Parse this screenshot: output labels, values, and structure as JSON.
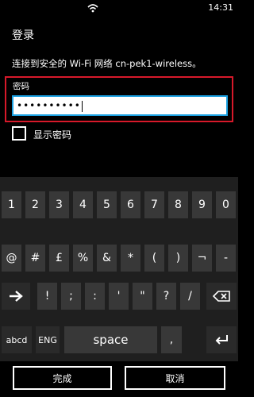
{
  "status": {
    "time": "14:31"
  },
  "page": {
    "title": "登录",
    "description": "连接到安全的 Wi-Fi 网络 cn-pek1-wireless。",
    "password_label": "密码",
    "password_value": "••••••••••",
    "show_password_label": "显示密码"
  },
  "keyboard": {
    "row1": [
      "1",
      "2",
      "3",
      "4",
      "5",
      "6",
      "7",
      "8",
      "9",
      "0"
    ],
    "row2": [
      "@",
      "#",
      "£",
      "%",
      "&",
      "*",
      "(",
      ")",
      "¬",
      "-"
    ],
    "row3": [
      "!",
      ";",
      ":",
      "'",
      "\"",
      "?",
      "/"
    ],
    "row4": {
      "abcd": "abcd",
      "eng": "ENG",
      "space": "space",
      "comma": ",",
      "enter_icon": "enter-icon"
    },
    "shift_icon": "arrow-right-icon",
    "backspace_icon": "backspace-icon"
  },
  "actions": {
    "done": "完成",
    "cancel": "取消"
  }
}
